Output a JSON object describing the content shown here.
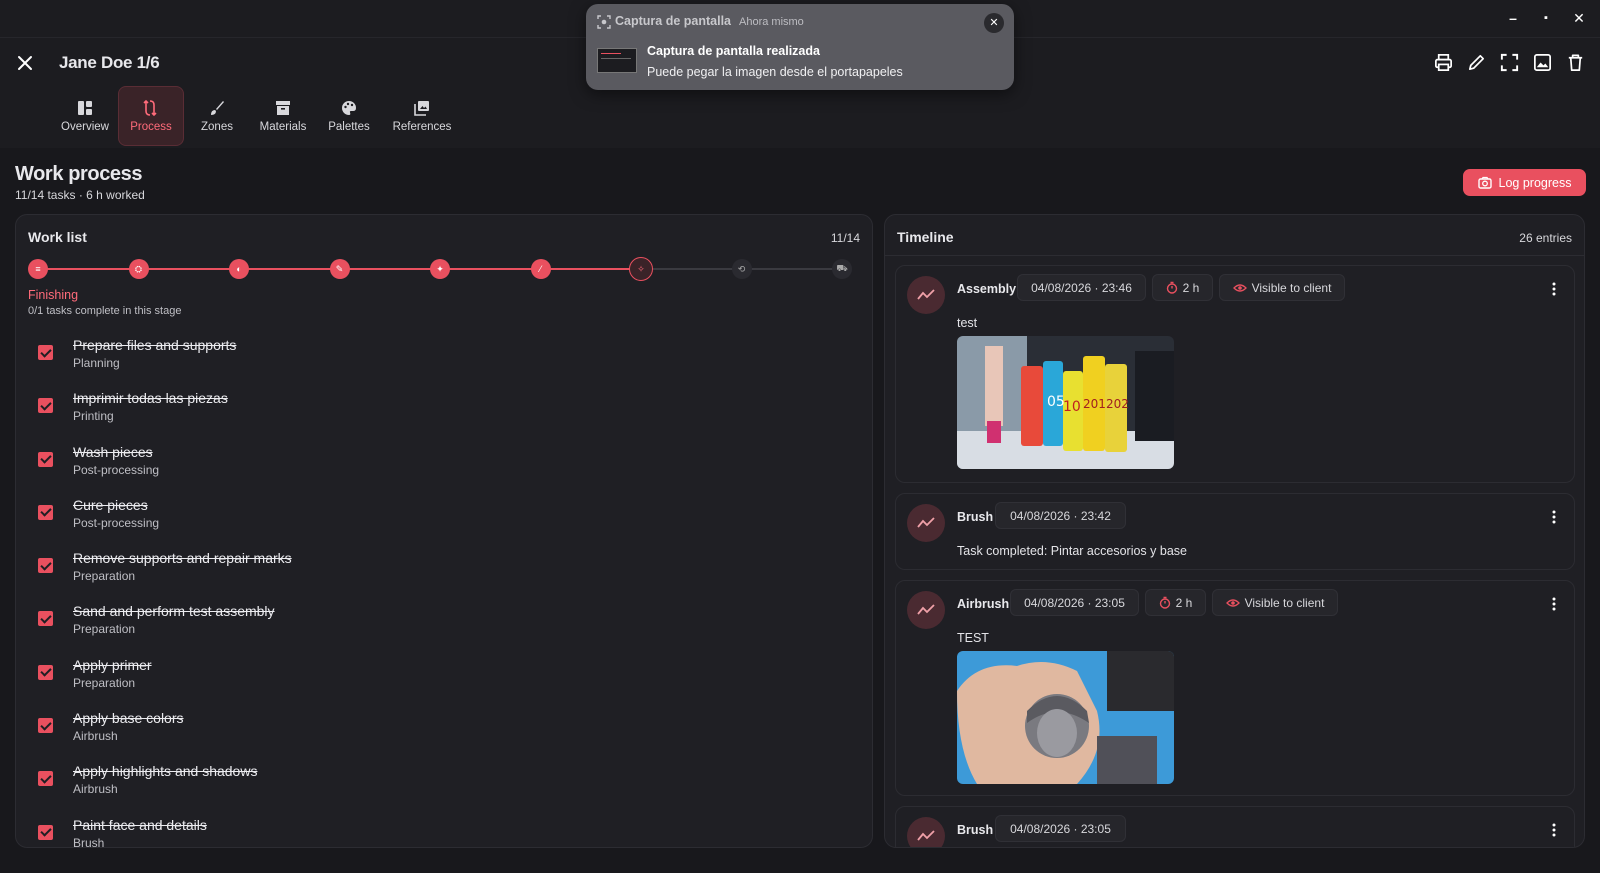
{
  "window": {
    "minimize": "–",
    "maximize": "▪",
    "close": "✕"
  },
  "header": {
    "title": "Jane Doe 1/6",
    "tabs": [
      {
        "label": "Overview",
        "icon": "dashboard-icon"
      },
      {
        "label": "Process",
        "icon": "process-icon",
        "active": true
      },
      {
        "label": "Zones",
        "icon": "brush-icon"
      },
      {
        "label": "Materials",
        "icon": "box-icon"
      },
      {
        "label": "Palettes",
        "icon": "palette-icon"
      },
      {
        "label": "References",
        "icon": "images-icon"
      }
    ],
    "actions": [
      "print-icon",
      "edit-icon",
      "fullscreen-icon",
      "image-icon",
      "trash-icon"
    ]
  },
  "page": {
    "title": "Work process",
    "subtitle": "11/14 tasks · 6 h worked",
    "log_button": "Log progress"
  },
  "colors": {
    "accent": "#e9505f",
    "background": "#18181c",
    "panel": "#1f1f24"
  },
  "worklist": {
    "title": "Work list",
    "count": "11/14",
    "stages_total": 9,
    "stages_done": 6,
    "current_stage_index": 6,
    "stage_name": "Finishing",
    "stage_progress": "0/1 tasks complete in this stage",
    "tasks": [
      {
        "name": "Prepare files and supports",
        "stage": "Planning"
      },
      {
        "name": "Imprimir todas las piezas",
        "stage": "Printing"
      },
      {
        "name": "Wash pieces",
        "stage": "Post-processing"
      },
      {
        "name": "Cure pieces",
        "stage": "Post-processing"
      },
      {
        "name": "Remove supports and repair marks",
        "stage": "Preparation"
      },
      {
        "name": "Sand and perform test assembly",
        "stage": "Preparation"
      },
      {
        "name": "Apply primer",
        "stage": "Preparation"
      },
      {
        "name": "Apply base colors",
        "stage": "Airbrush"
      },
      {
        "name": "Apply highlights and shadows",
        "stage": "Airbrush"
      },
      {
        "name": "Paint face and details",
        "stage": "Brush"
      }
    ]
  },
  "timeline": {
    "title": "Timeline",
    "count": "26 entries",
    "entries": [
      {
        "type": "Assembly",
        "date": "04/08/2026 · 23:46",
        "duration": "2 h",
        "visibility": "Visible to client",
        "note": "test"
      },
      {
        "type": "Brush",
        "date": "04/08/2026 · 23:42",
        "note": "Task completed: Pintar accesorios y base"
      },
      {
        "type": "Airbrush",
        "date": "04/08/2026 · 23:05",
        "duration": "2 h",
        "visibility": "Visible to client",
        "note": "TEST"
      },
      {
        "type": "Brush",
        "date": "04/08/2026 · 23:05"
      }
    ],
    "photo_labels": [
      "05",
      "10",
      "201",
      "202"
    ]
  },
  "toast": {
    "app": "Captura de pantalla",
    "time": "Ahora mismo",
    "title": "Captura de pantalla realizada",
    "body": "Puede pegar la imagen desde el portapapeles"
  }
}
